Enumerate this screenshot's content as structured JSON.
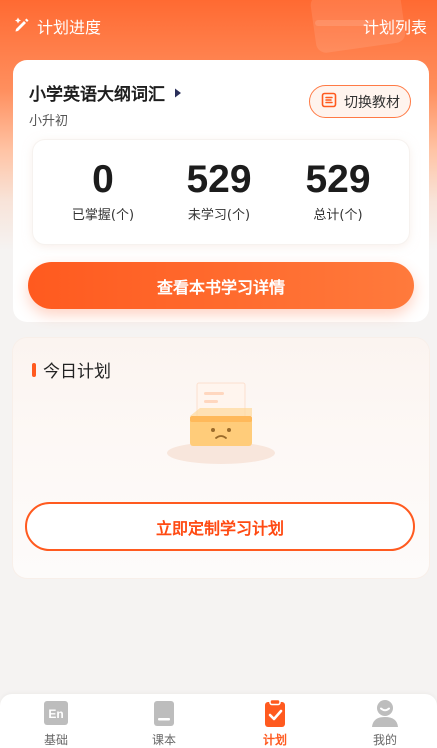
{
  "header": {
    "title": "计划进度",
    "right_link": "计划列表",
    "icon": "edit-pen-icon"
  },
  "book": {
    "title": "小学英语大纲词汇",
    "subtitle": "小升初",
    "switch_label": "切换教材",
    "stats": [
      {
        "value": "0",
        "label": "已掌握(个)"
      },
      {
        "value": "529",
        "label": "未学习(个)"
      },
      {
        "value": "529",
        "label": "总计(个)"
      }
    ],
    "detail_button": "查看本书学习详情"
  },
  "plan": {
    "title": "今日计划",
    "custom_button": "立即定制学习计划"
  },
  "tabs": [
    {
      "label": "基础",
      "icon": "en-book-icon",
      "active": false
    },
    {
      "label": "课本",
      "icon": "textbook-icon",
      "active": false
    },
    {
      "label": "计划",
      "icon": "clipboard-check-icon",
      "active": true
    },
    {
      "label": "我的",
      "icon": "user-icon",
      "active": false
    }
  ],
  "colors": {
    "accent": "#ff5a1f",
    "tab_inactive": "#b5b5b5",
    "text_dark": "#1e1e1e"
  }
}
